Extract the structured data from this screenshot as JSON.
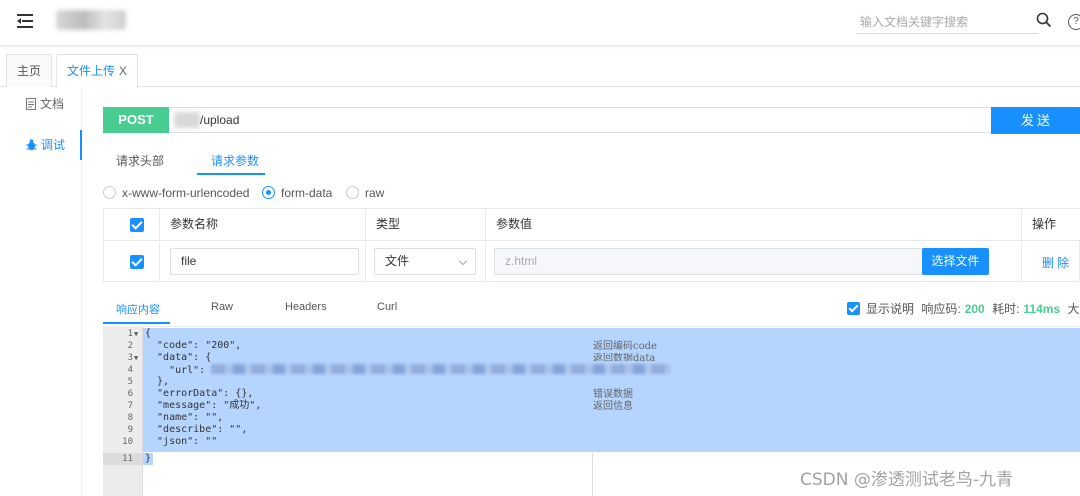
{
  "header": {
    "search_placeholder": "输入文档关键字搜索",
    "help_label": "?"
  },
  "tabs": [
    {
      "label": "主页"
    },
    {
      "label": "文件上传",
      "close": "X"
    }
  ],
  "sidebar": {
    "items": [
      {
        "label": "文档"
      },
      {
        "label": "调试"
      }
    ]
  },
  "request": {
    "method": "POST",
    "path": "/upload",
    "send_label": "发送"
  },
  "request_tabs": [
    "请求头部",
    "请求参数"
  ],
  "body_types": [
    "x-www-form-urlencoded",
    "form-data",
    "raw"
  ],
  "params_table": {
    "headers": [
      "参数名称",
      "类型",
      "参数值",
      "操作"
    ],
    "row": {
      "name": "file",
      "type": "文件",
      "value_placeholder": "z.html",
      "choose_label": "选择文件",
      "delete_label": "删除"
    }
  },
  "response": {
    "tabs": [
      "响应内容",
      "Raw",
      "Headers",
      "Curl"
    ],
    "show_desc_label": "显示说明",
    "code_label": "响应码:",
    "code_value": "200",
    "time_label": "耗时:",
    "time_value": "114ms",
    "size_label": "大小"
  },
  "code_lines": [
    {
      "n": "1",
      "fold": "▼",
      "text": "{"
    },
    {
      "n": "2",
      "fold": "",
      "text": "  \"code\": \"200\","
    },
    {
      "n": "3",
      "fold": "▼",
      "text": "  \"data\": {"
    },
    {
      "n": "4",
      "fold": "",
      "text": "    \"url\": "
    },
    {
      "n": "5",
      "fold": "",
      "text": "  },"
    },
    {
      "n": "6",
      "fold": "",
      "text": "  \"errorData\": {},"
    },
    {
      "n": "7",
      "fold": "",
      "text": "  \"message\": \"成功\","
    },
    {
      "n": "8",
      "fold": "",
      "text": "  \"name\": \"\","
    },
    {
      "n": "9",
      "fold": "",
      "text": "  \"describe\": \"\","
    },
    {
      "n": "10",
      "fold": "",
      "text": "  \"json\": \"\""
    },
    {
      "n": "11",
      "fold": "",
      "text": "}"
    }
  ],
  "notes": {
    "code": "返回编码code",
    "data": "返回数据data",
    "error": "错误数据",
    "message": "返回信息"
  },
  "watermark": "CSDN @渗透测试老鸟-九青",
  "colors": {
    "primary": "#1890ff",
    "post": "#49cc90",
    "selection": "#b5d5ff"
  }
}
